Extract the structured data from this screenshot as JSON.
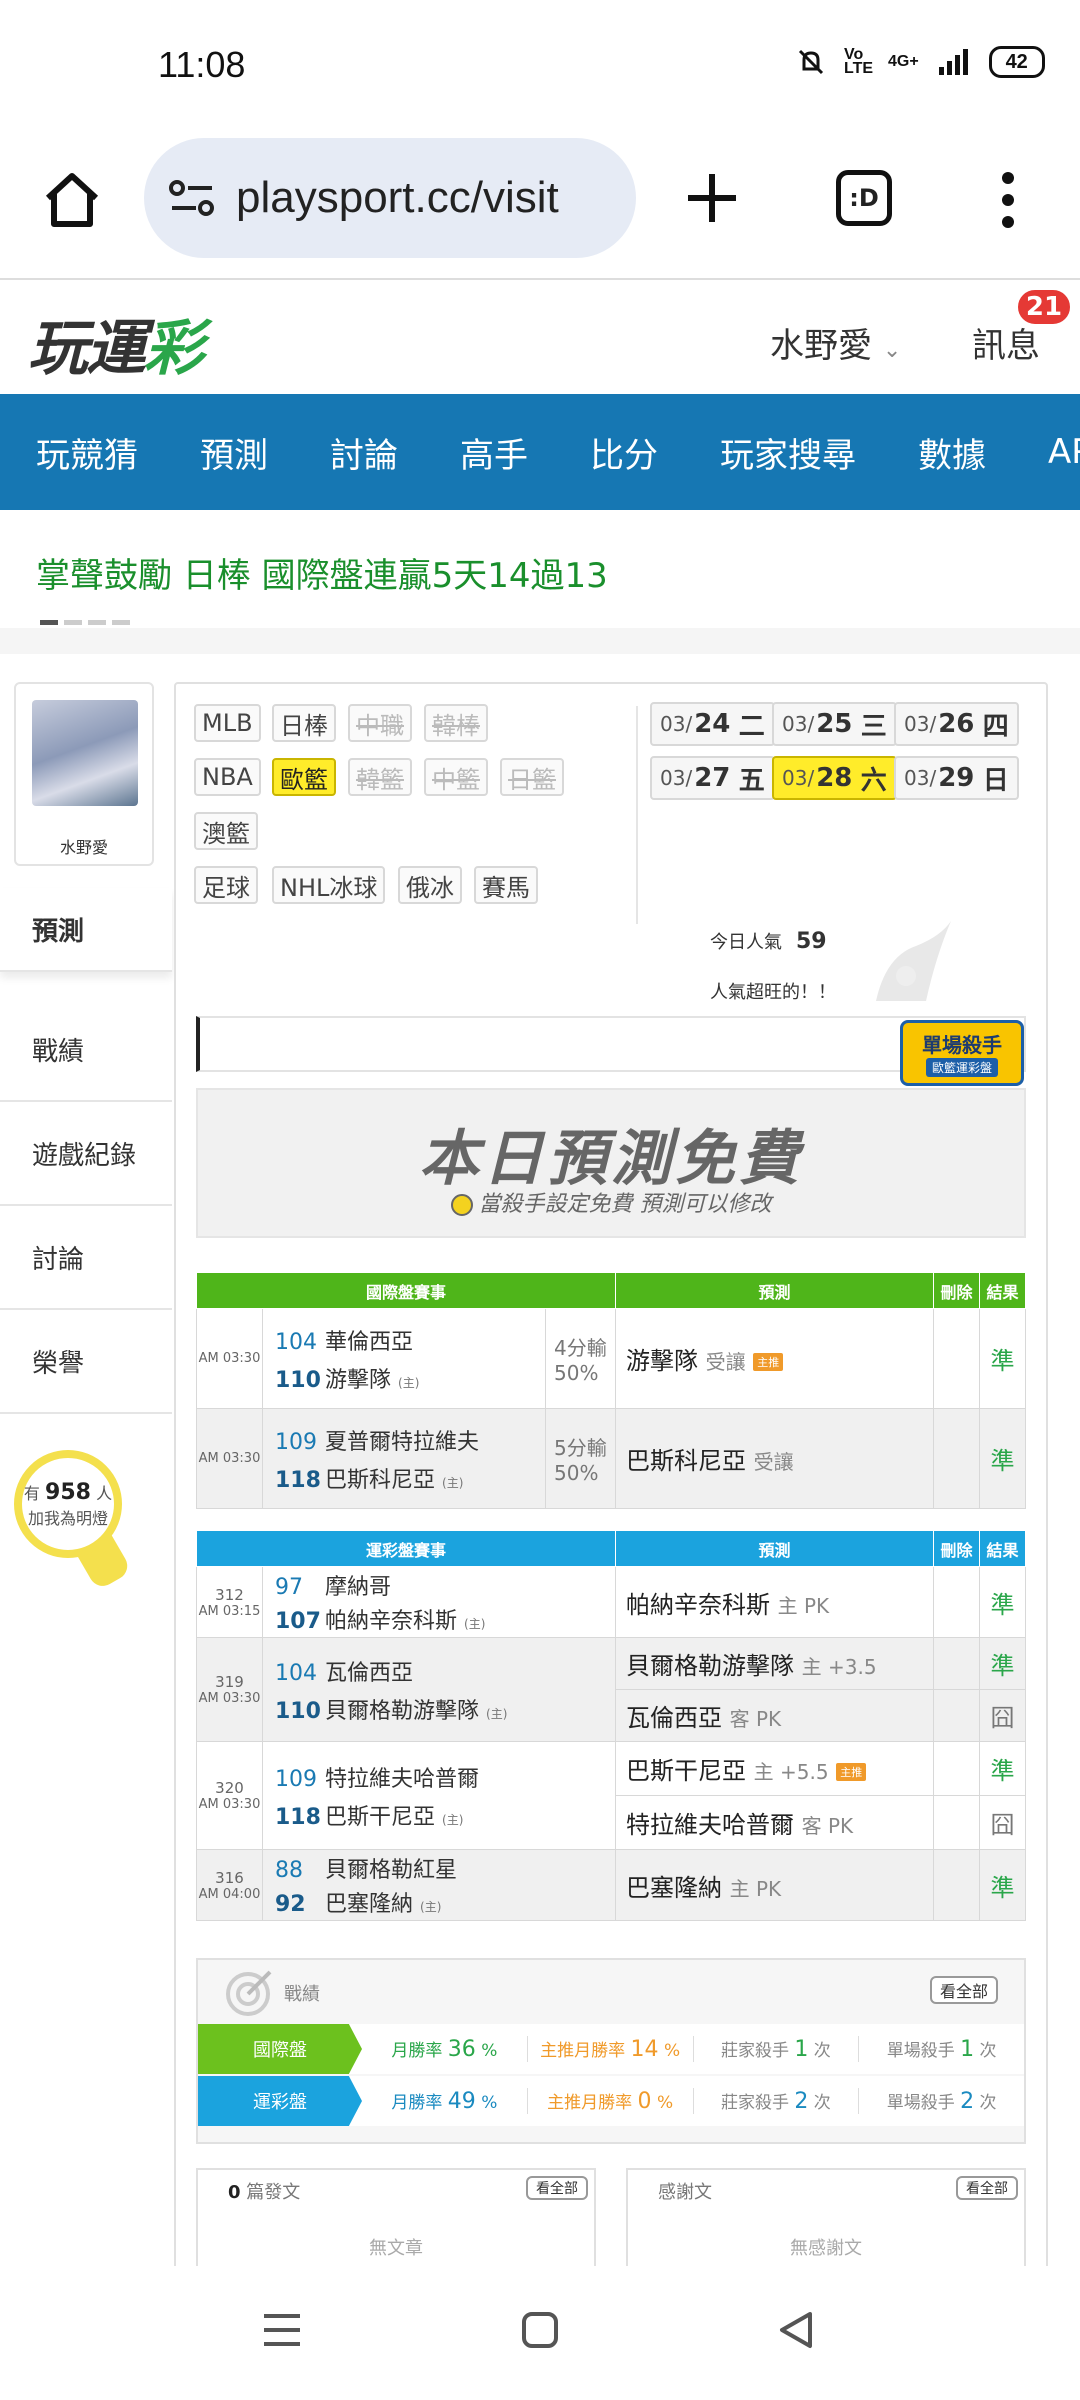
{
  "status_bar": {
    "time": "11:08",
    "signal_text": "Vo LTE",
    "network": "4G+",
    "battery": "42"
  },
  "browser": {
    "url": "playsport.cc/visit",
    "tabs_label": ":D"
  },
  "site": {
    "logo_text_a": "玩運",
    "logo_text_b": "彩",
    "username": "水野愛",
    "messages_label": "訊息",
    "messages_count": "21",
    "nav": [
      "玩競猜",
      "預測",
      "討論",
      "高手",
      "比分",
      "玩家搜尋",
      "數據",
      "APP"
    ],
    "ticker": "掌聲鼓勵 日棒 國際盤連贏5天14過13"
  },
  "sidebar": {
    "avatar_name": "水野愛",
    "menu": [
      "預測",
      "戰績",
      "遊戲紀錄",
      "討論",
      "榮譽"
    ],
    "light": {
      "prefix": "有",
      "count": "958",
      "suffix": "人",
      "caption": "加我為明燈"
    }
  },
  "sport_tags": {
    "row1": [
      "MLB",
      "日棒",
      "中職",
      "韓棒"
    ],
    "row2": [
      "NBA",
      "歐籃",
      "韓籃",
      "中籃",
      "日籃"
    ],
    "row3": [
      "澳籃"
    ],
    "row4": [
      "足球",
      "NHL冰球",
      "俄冰",
      "賽馬"
    ]
  },
  "dates": [
    {
      "md": "03/",
      "d": "24",
      "w": "二"
    },
    {
      "md": "03/",
      "d": "25",
      "w": "三"
    },
    {
      "md": "03/",
      "d": "26",
      "w": "四"
    },
    {
      "md": "03/",
      "d": "27",
      "w": "五"
    },
    {
      "md": "03/",
      "d": "28",
      "w": "六"
    },
    {
      "md": "03/",
      "d": "29",
      "w": "日"
    }
  ],
  "popularity": {
    "label": "今日人氣",
    "value": "59",
    "note": "人氣超旺的！！"
  },
  "kill_badge": {
    "title": "單場殺手",
    "sub": "歐籃運彩盤"
  },
  "free_banner": {
    "title": "本日預測免費",
    "subtitle": "當殺手設定免費 預測可以修改"
  },
  "intl_table": {
    "headers": [
      "國際盤賽事",
      "預測",
      "刪除",
      "結果"
    ],
    "rows": [
      {
        "time": "AM 03:30",
        "away_no": "104",
        "away": "華倫西亞",
        "home_no": "110",
        "home": "游擊隊",
        "home_tag": "(主)",
        "odds1": "4分輸",
        "odds2": "50%",
        "pick": "游擊隊",
        "pick_s": "受讓",
        "pick_tag": "主推",
        "result": "準"
      },
      {
        "time": "AM 03:30",
        "away_no": "109",
        "away": "夏普爾特拉維夫",
        "home_no": "118",
        "home": "巴斯科尼亞",
        "home_tag": "(主)",
        "odds1": "5分輸",
        "odds2": "50%",
        "pick": "巴斯科尼亞",
        "pick_s": "受讓",
        "pick_tag": "",
        "result": "準"
      }
    ]
  },
  "lottery_table": {
    "headers": [
      "運彩盤賽事",
      "預測",
      "刪除",
      "結果"
    ],
    "games": [
      {
        "id": "312",
        "time": "AM 03:15",
        "away_no": "97",
        "away": "摩納哥",
        "home_no": "107",
        "home": "帕納辛奈科斯",
        "home_tag": "(主)",
        "picks": [
          {
            "team": "帕納辛奈科斯",
            "s": "主 PK",
            "tag": "",
            "result": "準"
          }
        ]
      },
      {
        "id": "319",
        "time": "AM 03:30",
        "away_no": "104",
        "away": "瓦倫西亞",
        "home_no": "110",
        "home": "貝爾格勒游擊隊",
        "home_tag": "(主)",
        "picks": [
          {
            "team": "貝爾格勒游擊隊",
            "s": "主 +3.5",
            "tag": "",
            "result": "準"
          },
          {
            "team": "瓦倫西亞",
            "s": "客 PK",
            "tag": "",
            "result": "囧"
          }
        ]
      },
      {
        "id": "320",
        "time": "AM 03:30",
        "away_no": "109",
        "away": "特拉維夫哈普爾",
        "home_no": "118",
        "home": "巴斯干尼亞",
        "home_tag": "(主)",
        "picks": [
          {
            "team": "巴斯干尼亞",
            "s": "主 +5.5",
            "tag": "主推",
            "result": "準"
          },
          {
            "team": "特拉維夫哈普爾",
            "s": "客 PK",
            "tag": "",
            "result": "囧"
          }
        ]
      },
      {
        "id": "316",
        "time": "AM 04:00",
        "away_no": "88",
        "away": "貝爾格勒紅星",
        "home_no": "92",
        "home": "巴塞隆納",
        "home_tag": "(主)",
        "picks": [
          {
            "team": "巴塞隆納",
            "s": "主 PK",
            "tag": "",
            "result": "準"
          }
        ]
      }
    ]
  },
  "stats": {
    "title": "戰績",
    "see_all": "看全部",
    "rows": [
      {
        "label": "國際盤",
        "color": "#6cc11e",
        "m_label": "月勝率",
        "m_val": "36",
        "h_label": "主推月勝率",
        "h_val": "14",
        "b_label": "莊家殺手",
        "b_val": "1",
        "b_unit": "次",
        "s_label": "單場殺手",
        "s_val": "1",
        "s_unit": "次"
      },
      {
        "label": "運彩盤",
        "color": "#1ba3de",
        "m_label": "月勝率",
        "m_val": "49",
        "h_label": "主推月勝率",
        "h_val": "0",
        "b_label": "莊家殺手",
        "b_val": "2",
        "b_unit": "次",
        "s_label": "單場殺手",
        "s_val": "2",
        "s_unit": "次"
      }
    ],
    "pct": "%"
  },
  "posts": {
    "count": "0",
    "label": "篇發文",
    "see_all": "看全部",
    "empty": "無文章"
  },
  "thanks": {
    "label": "感謝文",
    "see_all": "看全部",
    "empty": "無感謝文"
  },
  "colors": {
    "nav_blue": "#1677b3",
    "green": "#4fb51a",
    "sky": "#1ba3de",
    "yellow": "#ffec2a",
    "badge_red": "#e53935"
  }
}
